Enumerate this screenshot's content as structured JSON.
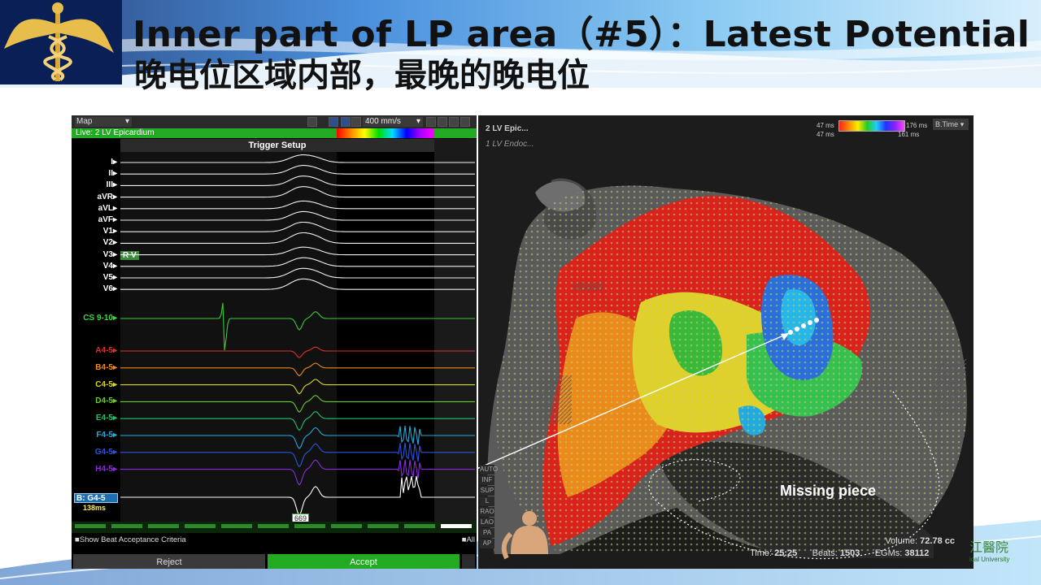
{
  "slide": {
    "title_en": "Inner part of LP area（#5）：Latest Potential",
    "title_cn": "晚电位区域内部，最晚的晚电位",
    "university_logo": {
      "chars": "江醫院",
      "text": "ical University"
    }
  },
  "egm": {
    "map_label": "Map",
    "sweep_speed": "400 mm/s",
    "live_label": "Live: 2 LV Epicardium",
    "trigger_label": "Trigger Setup",
    "rv_tag": "R V",
    "surface_leads": [
      "I",
      "II",
      "III",
      "aVR",
      "aVL",
      "aVF",
      "V1",
      "V2",
      "V3",
      "V4",
      "V5",
      "V6"
    ],
    "cs_lead": "CS 9-10",
    "pentaray_leads": [
      {
        "name": "A4-5",
        "color": "#e0302a"
      },
      {
        "name": "B4-5",
        "color": "#f08a1a"
      },
      {
        "name": "C4-5",
        "color": "#d8d81a"
      },
      {
        "name": "D4-5",
        "color": "#6acc2a"
      },
      {
        "name": "E4-5",
        "color": "#1ec46a"
      },
      {
        "name": "F4-5",
        "color": "#22aadd"
      },
      {
        "name": "G4-5",
        "color": "#2a55e0"
      },
      {
        "name": "H4-5",
        "color": "#8a2ae0"
      }
    ],
    "b_label": "B: G4-5",
    "b_ms": "138ms",
    "value_669": "669",
    "show_criteria": "Show Beat Acceptance Criteria",
    "all_label": "All",
    "reject_label": "Reject",
    "accept_label": "Accept"
  },
  "map3d": {
    "map_list": [
      "2 LV Epic...",
      "1 LV Endoc..."
    ],
    "scale": {
      "min_top": "47 ms",
      "min_bot": "47 ms",
      "max_top": "176 ms",
      "max_bot": "161 ms"
    },
    "mode_select": "B.Time",
    "side_buttons": [
      "AUTO",
      "INF",
      "SUP",
      "L",
      "RAO",
      "LAO",
      "PA",
      "AP"
    ],
    "annotation": "Missing piece",
    "stats": {
      "volume_label": "Volume:",
      "volume": "72.78 cc",
      "time_label": "Time:",
      "time": "25:25",
      "beats_label": "Beats:",
      "beats": "1503",
      "egms_label": "EGMs:",
      "egms": "38112"
    }
  }
}
